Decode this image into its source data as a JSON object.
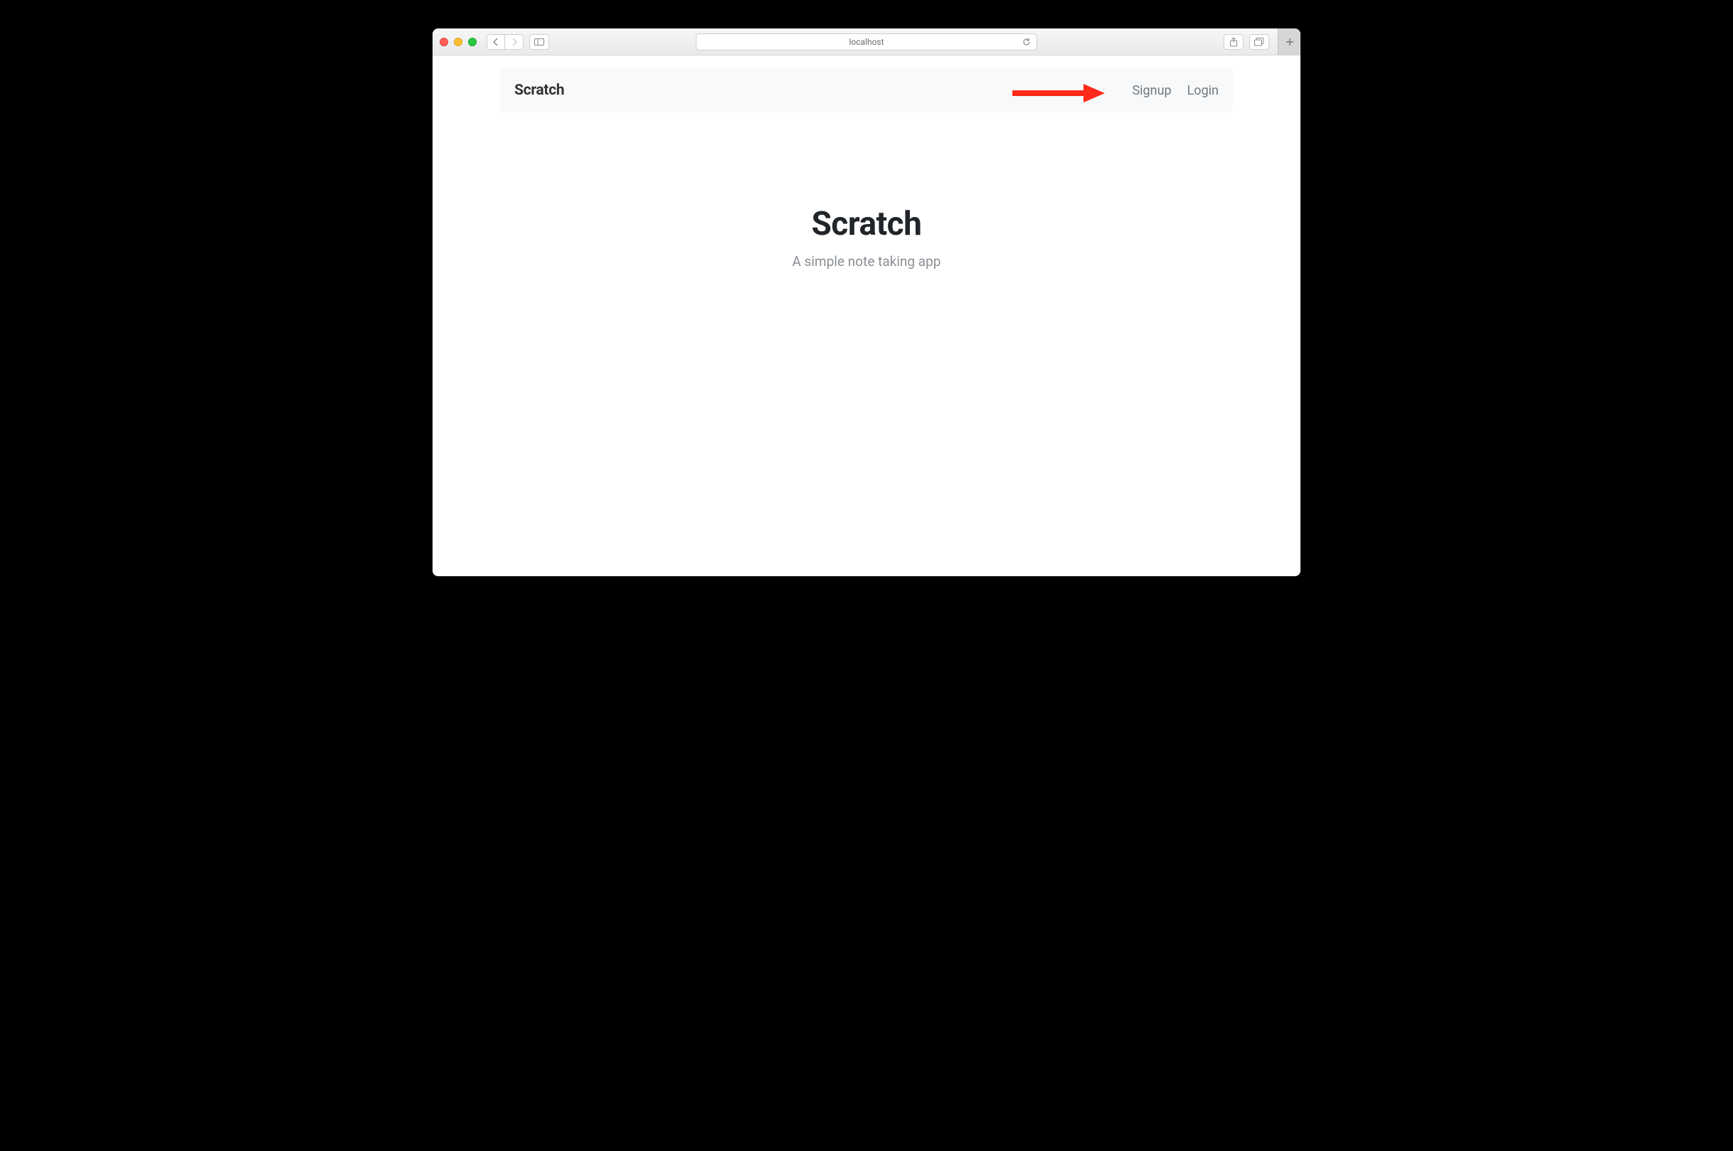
{
  "browser": {
    "address": "localhost"
  },
  "navbar": {
    "brand": "Scratch",
    "links": {
      "signup": "Signup",
      "login": "Login"
    }
  },
  "hero": {
    "title": "Scratch",
    "subtitle": "A simple note taking app"
  }
}
